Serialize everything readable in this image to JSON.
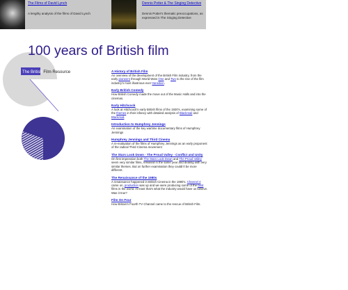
{
  "promos": [
    {
      "title": "The Films of David Lynch",
      "text": "A lengthy analysis of the films of David Lynch"
    },
    {
      "title": "Dennis Potter & The Singing Detective",
      "text": "Dennis Potter's thematic preoccupations, as expressed in The Singing Detective"
    }
  ],
  "page_title": "100 years of British film",
  "logo": {
    "the": "The",
    "brand": "British",
    "rest": "Film Resource"
  },
  "items": [
    {
      "title": "A History of British Film",
      "desc_parts": [
        "An overview of the development of the British Film industry, from the early ",
        "pioneers",
        " through World Wars ",
        "One",
        " and ",
        "Two",
        " to the rise of the film industry's most illustrious ever ",
        "transition",
        "."
      ]
    },
    {
      "title": "Early British Comedy",
      "desc_parts": [
        "How British Comedy made the move out of the Music Halls and into the cinemas."
      ]
    },
    {
      "title": "Early Hitchcock",
      "desc_parts": [
        "A look at Hitchcock's early British films of the 1920's, examining some of the ",
        "themes",
        " in their infancy with detailed analysis of ",
        "Blackmail",
        " and ",
        "Blackmail",
        "."
      ]
    },
    {
      "title": "Introduction to Humphrey Jennings",
      "desc_parts": [
        "An examination of the key wartime documentary films of Humphrey Jennings"
      ]
    },
    {
      "title": "Humphrey Jennings and Third Cinema",
      "desc_parts": [
        "A re-evaluation of the films of Humphrey Jennings as an early proponent of the radical Third Cinema movement"
      ]
    },
    {
      "title": "The Stars Look Down - The Proud Valley - Conflict and Unity",
      "desc_parts": [
        "On first impression both ",
        "The Stars Look Down",
        " and ",
        "The Proud Valley",
        " seem very similar films, released in the same year and dealing with very similar themes. But on further examination they couldn't be more different."
      ]
    },
    {
      "title": "The Renaissance of the 1980s",
      "desc_parts": [
        "A renaissance happened in British Cinema in the 1980's. ",
        "Channel 4",
        " came on, ",
        "production",
        " was up and we were producing some of the ",
        "best",
        " films in the world. At least that's what the industry would have us believe. Was it true?"
      ]
    },
    {
      "title": "Film On Four",
      "desc_parts": [
        "How Britain's Fourth TV Channel came to the rescue of British Film."
      ]
    }
  ]
}
